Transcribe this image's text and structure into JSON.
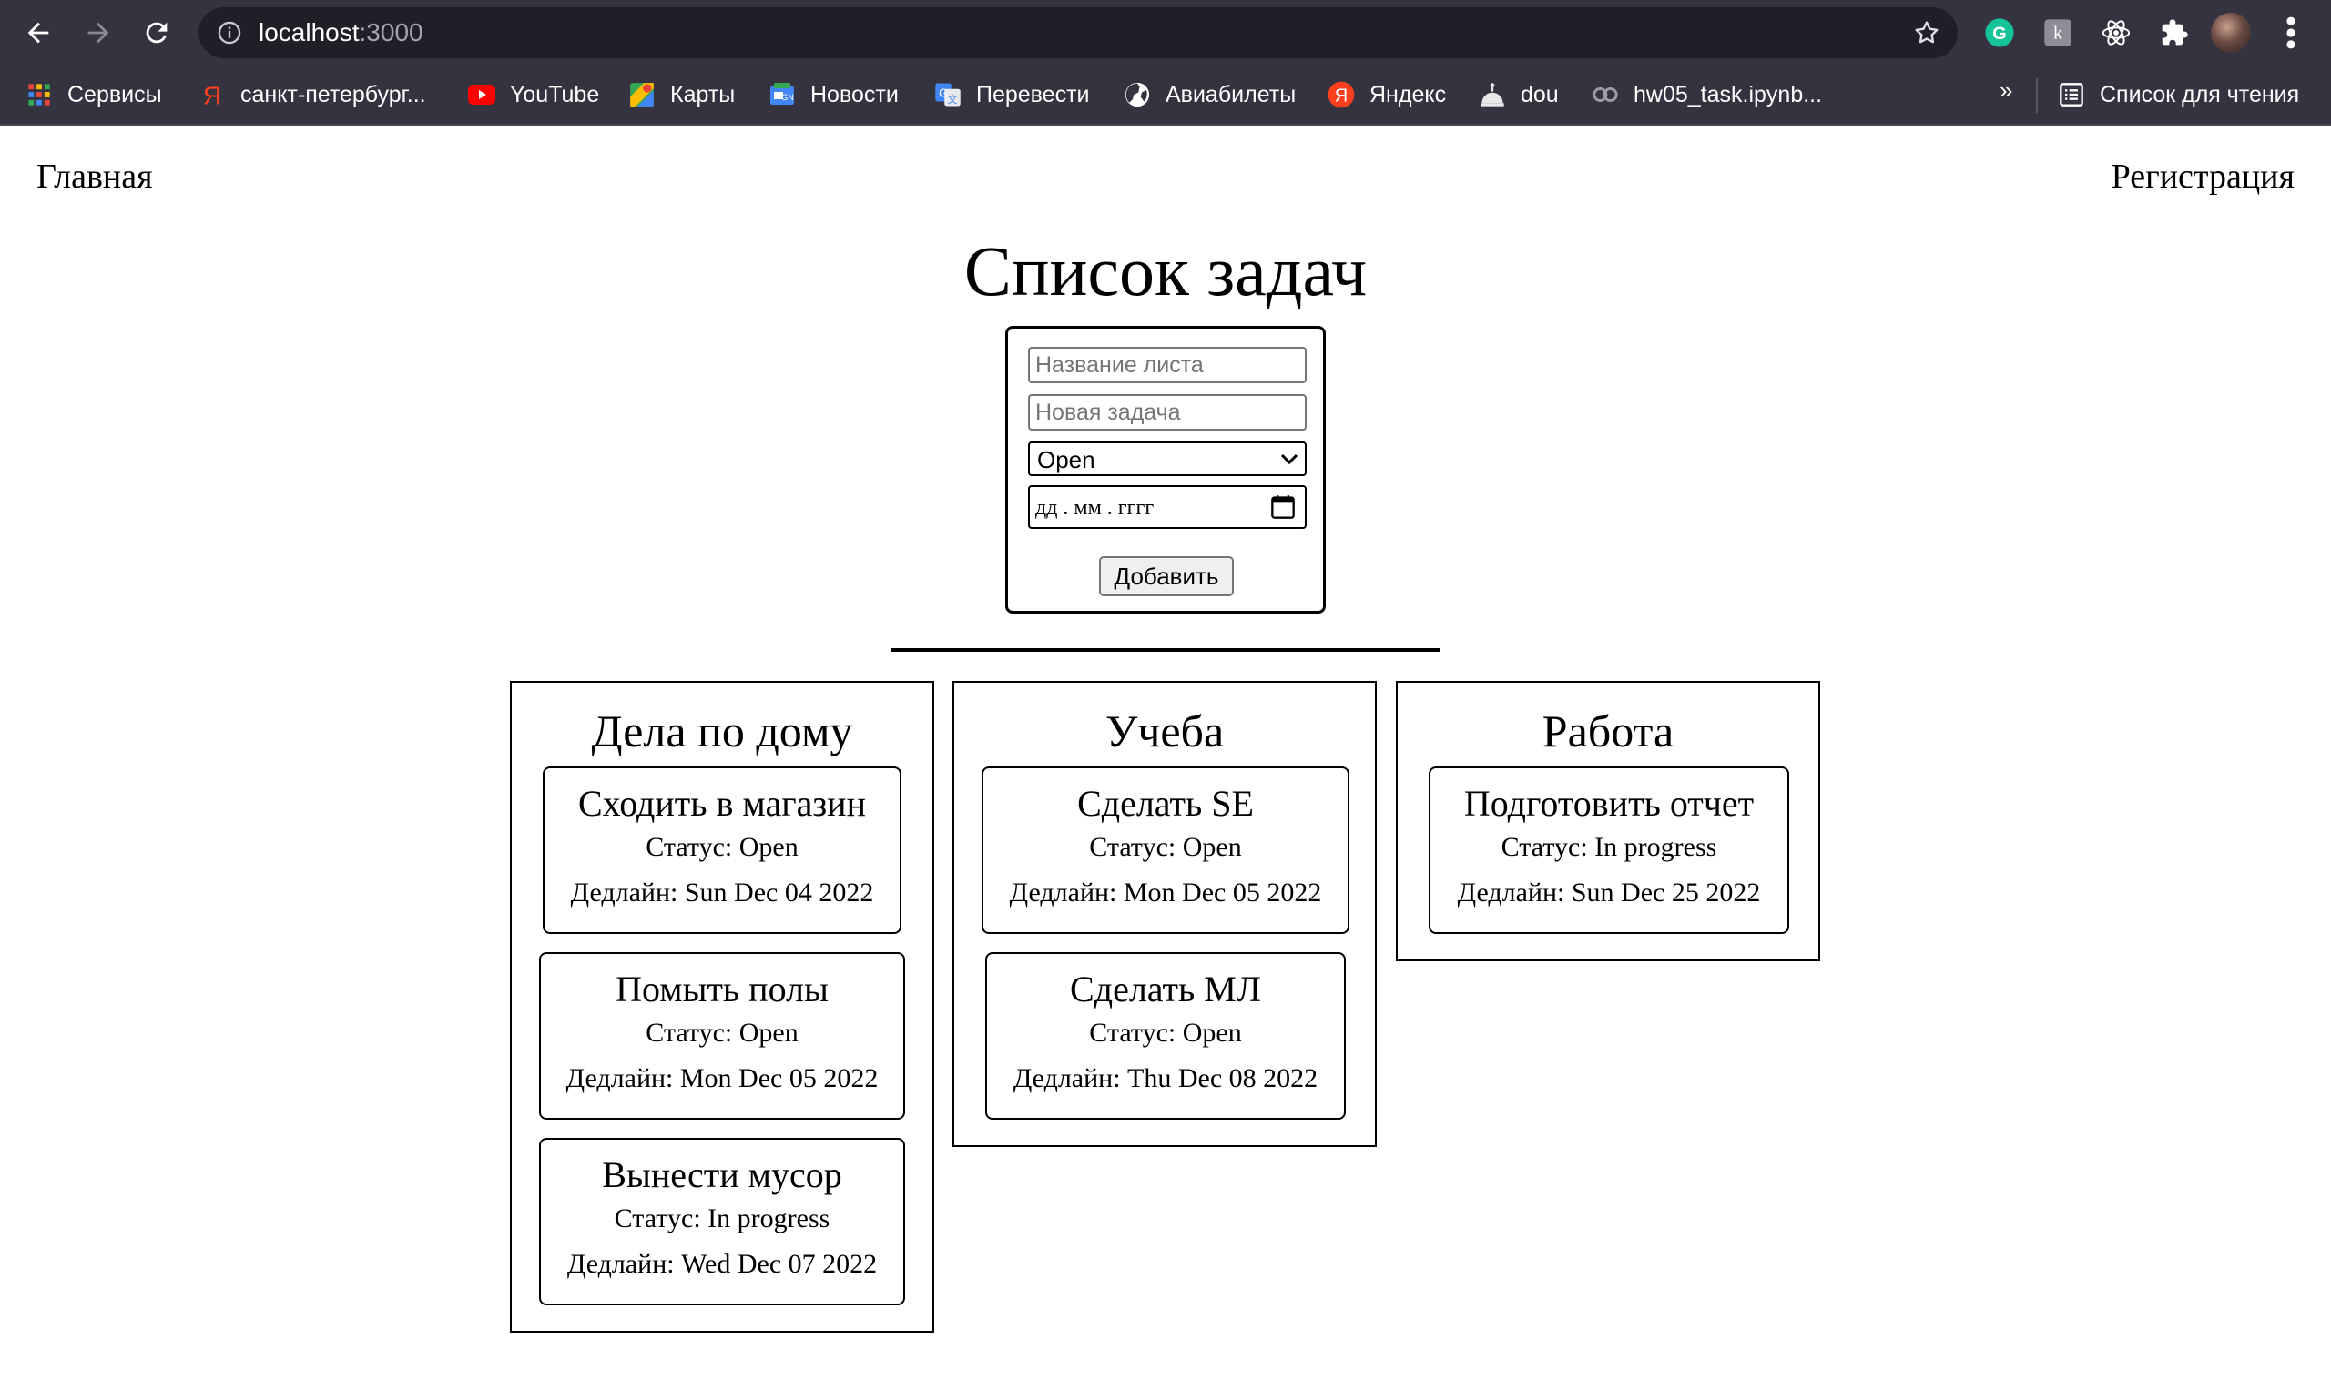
{
  "browser": {
    "url_host": "localhost",
    "url_port": ":3000",
    "bookmarks": [
      {
        "label": "Сервисы",
        "icon": "apps-grid-icon"
      },
      {
        "label": "санкт-петербург...",
        "icon": "yandex-y-icon"
      },
      {
        "label": "YouTube",
        "icon": "youtube-icon"
      },
      {
        "label": "Карты",
        "icon": "maps-icon"
      },
      {
        "label": "Новости",
        "icon": "news-icon"
      },
      {
        "label": "Перевести",
        "icon": "translate-icon"
      },
      {
        "label": "Авиабилеты",
        "icon": "globe-icon"
      },
      {
        "label": "Яндекс",
        "icon": "yandex-icon"
      },
      {
        "label": "dou",
        "icon": "dou-icon"
      },
      {
        "label": "hw05_task.ipynb...",
        "icon": "colab-icon"
      }
    ],
    "more_label": "»",
    "reading_list_label": "Список для чтения"
  },
  "nav": {
    "home_label": "Главная",
    "register_label": "Регистрация"
  },
  "page": {
    "title": "Список задач"
  },
  "form": {
    "list_name_placeholder": "Название листа",
    "task_placeholder": "Новая задача",
    "status_value": "Open",
    "date_placeholder": "дд . мм . гггг",
    "add_label": "Добавить"
  },
  "lists": [
    {
      "title": "Дела по дому",
      "tasks": [
        {
          "title": "Сходить в магазин",
          "status": "Статус: Open",
          "deadline": "Дедлайн: Sun Dec 04 2022"
        },
        {
          "title": "Помыть полы",
          "status": "Статус: Open",
          "deadline": "Дедлайн: Mon Dec 05 2022"
        },
        {
          "title": "Вынести мусор",
          "status": "Статус: In progress",
          "deadline": "Дедлайн: Wed Dec 07 2022"
        }
      ]
    },
    {
      "title": "Учеба",
      "tasks": [
        {
          "title": "Сделать SE",
          "status": "Статус: Open",
          "deadline": "Дедлайн: Mon Dec 05 2022"
        },
        {
          "title": "Сделать МЛ",
          "status": "Статус: Open",
          "deadline": "Дедлайн: Thu Dec 08 2022"
        }
      ]
    },
    {
      "title": "Работа",
      "tasks": [
        {
          "title": "Подготовить отчет",
          "status": "Статус: In progress",
          "deadline": "Дедлайн: Sun Dec 25 2022"
        }
      ]
    }
  ]
}
